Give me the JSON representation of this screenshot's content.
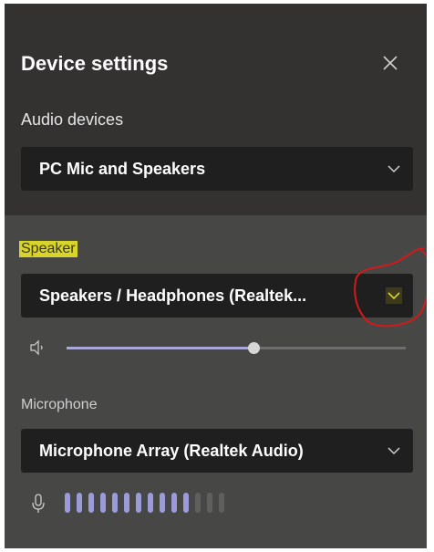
{
  "title": "Device settings",
  "close_icon": "close-icon",
  "audio_devices": {
    "label": "Audio devices",
    "selected": "PC Mic and Speakers"
  },
  "speaker": {
    "label": "Speaker",
    "selected": "Speakers / Headphones (Realtek...",
    "volume_fraction": 0.55,
    "highlight_color": "#d9d42a",
    "annotation_color": "#d11a1a"
  },
  "microphone": {
    "label": "Microphone",
    "selected": "Microphone Array (Realtek Audio)",
    "level_bars_total": 14,
    "level_bars_active": 11
  },
  "colors": {
    "panel_top": "#333231",
    "panel_bottom": "#474746",
    "dropdown_bg": "#1f1f1f",
    "accent": "#9c9bd9"
  }
}
